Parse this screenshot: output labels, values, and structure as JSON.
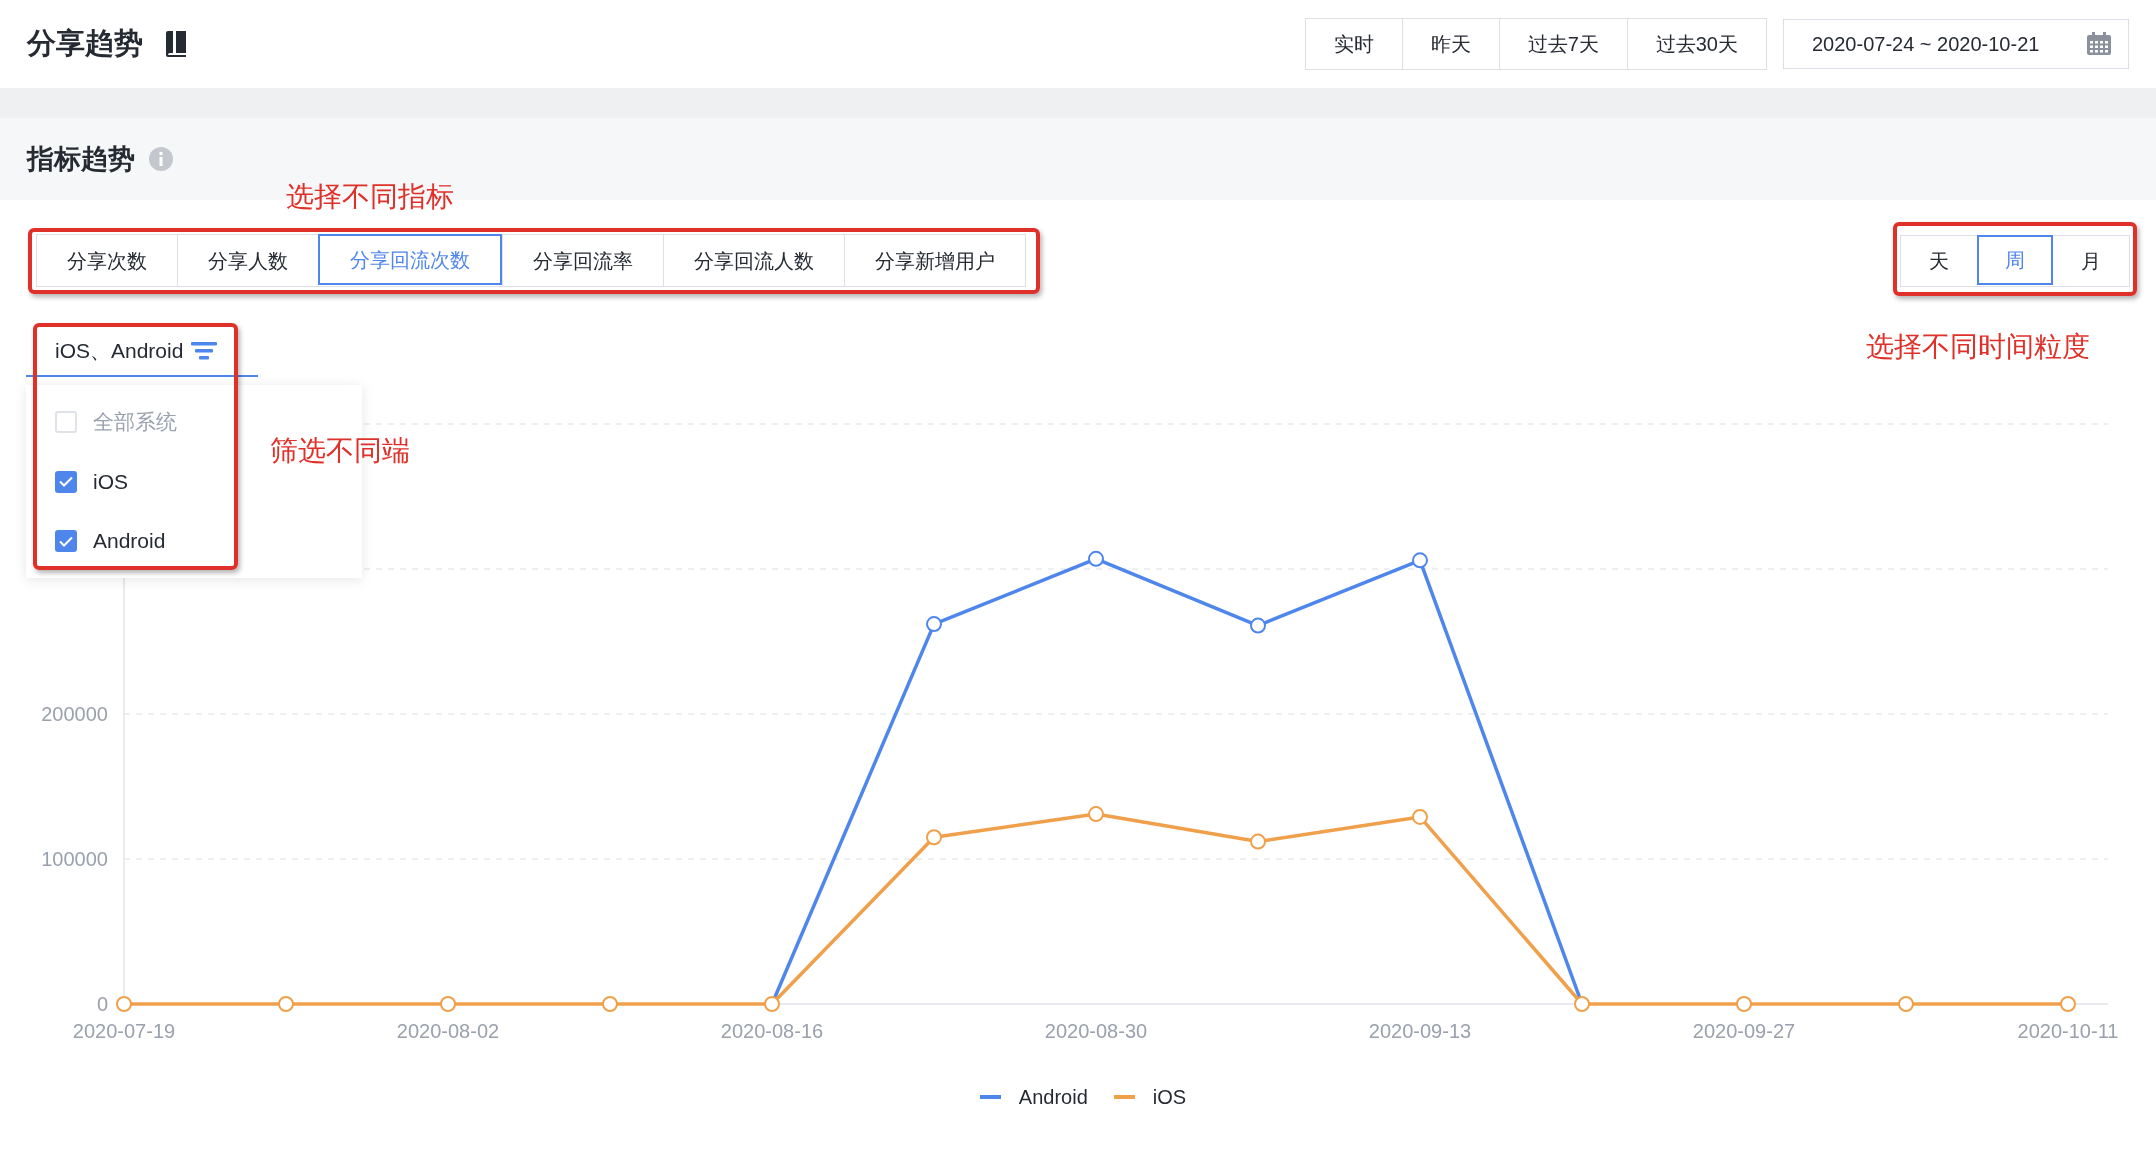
{
  "header": {
    "title": "分享趋势",
    "time_buttons": [
      {
        "label": "实时",
        "selected": false
      },
      {
        "label": "昨天",
        "selected": false
      },
      {
        "label": "过去7天",
        "selected": false
      },
      {
        "label": "过去30天",
        "selected": false
      }
    ],
    "date_range": "2020-07-24 ~ 2020-10-21"
  },
  "section": {
    "title": "指标趋势"
  },
  "metric_tabs": [
    {
      "label": "分享次数",
      "selected": false
    },
    {
      "label": "分享人数",
      "selected": false
    },
    {
      "label": "分享回流次数",
      "selected": true
    },
    {
      "label": "分享回流率",
      "selected": false
    },
    {
      "label": "分享回流人数",
      "selected": false
    },
    {
      "label": "分享新增用户",
      "selected": false
    }
  ],
  "granularity_tabs": [
    {
      "label": "天",
      "selected": false
    },
    {
      "label": "周",
      "selected": true
    },
    {
      "label": "月",
      "selected": false
    }
  ],
  "platform_filter": {
    "value": "iOS、Android",
    "options": [
      {
        "label": "全部系统",
        "checked": false
      },
      {
        "label": "iOS",
        "checked": true
      },
      {
        "label": "Android",
        "checked": true
      }
    ]
  },
  "annotations": {
    "metrics": "选择不同指标",
    "platforms": "筛选不同端",
    "granularity": "选择不同时间粒度"
  },
  "chart": {
    "chart_data": {
      "type": "line",
      "categories": [
        "2020-07-19",
        null,
        "2020-08-02",
        null,
        "2020-08-16",
        null,
        "2020-08-30",
        null,
        "2020-09-13",
        null,
        "2020-09-27",
        null,
        "2020-10-11"
      ],
      "yticks": [
        0,
        100000,
        200000
      ],
      "ylim": [
        0,
        400000
      ],
      "series": [
        {
          "name": "Android",
          "color": "#4f86ec",
          "marker": true,
          "values": [
            null,
            null,
            null,
            null,
            0,
            262000,
            307000,
            261000,
            306000,
            0,
            null,
            null,
            null
          ]
        },
        {
          "name": "iOS",
          "color": "#f0a04b",
          "marker": true,
          "values": [
            0,
            0,
            0,
            0,
            0,
            115000,
            131000,
            112000,
            129000,
            0,
            0,
            0,
            0
          ]
        }
      ]
    }
  }
}
